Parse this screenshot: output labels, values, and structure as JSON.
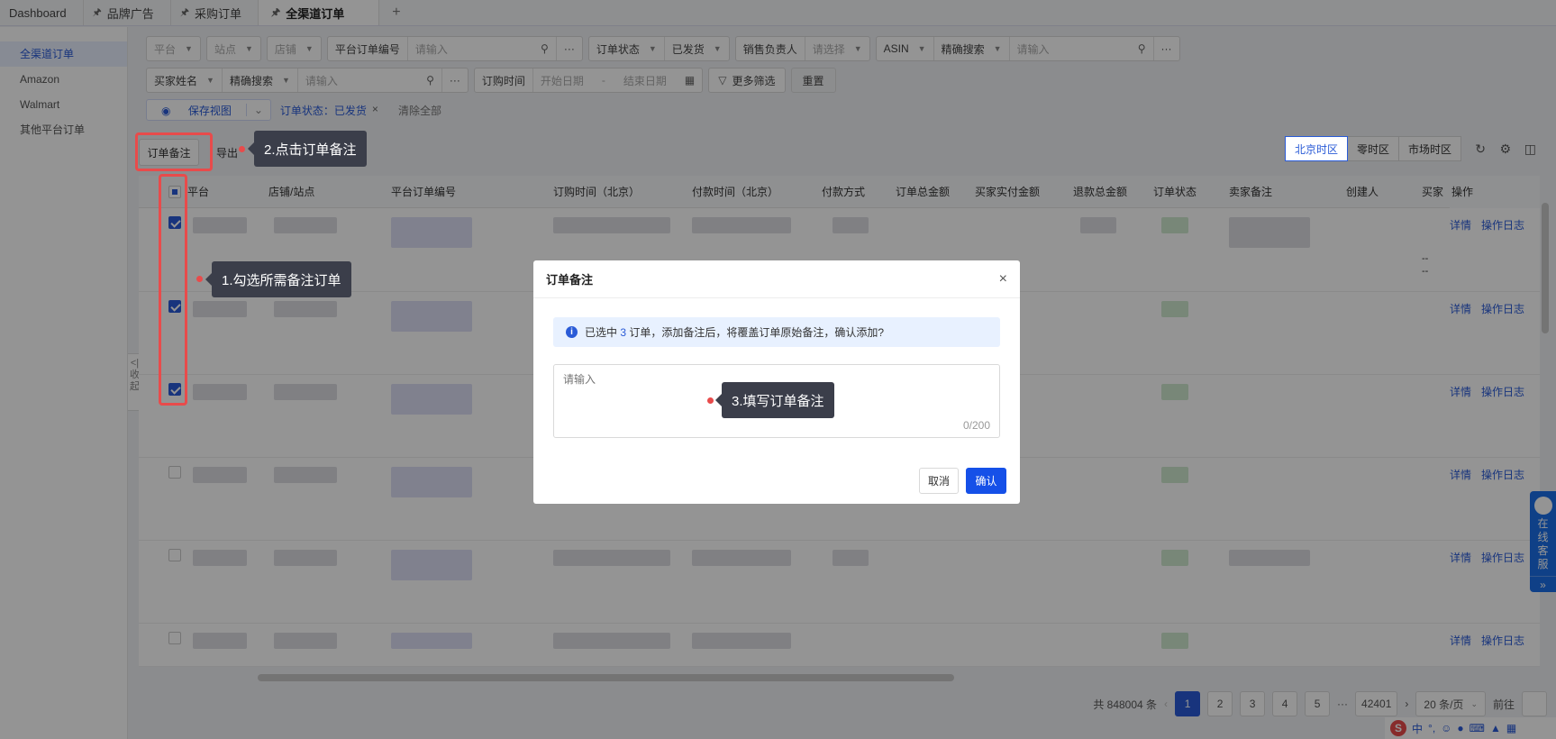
{
  "tabs": [
    {
      "label": "Dashboard",
      "pinned": false
    },
    {
      "label": "品牌广告",
      "pinned": true
    },
    {
      "label": "采购订单",
      "pinned": true
    },
    {
      "label": "全渠道订单",
      "pinned": true,
      "active": true
    }
  ],
  "tab_add": "+",
  "sidebar": {
    "items": [
      {
        "label": "全渠道订单",
        "active": true
      },
      {
        "label": "Amazon"
      },
      {
        "label": "Walmart"
      },
      {
        "label": "其他平台订单"
      }
    ],
    "collapse_label": "<| 收起"
  },
  "filters": {
    "platform": "平台",
    "site": "站点",
    "store": "店铺",
    "platform_order_no": "平台订单编号",
    "input_placeholder": "请输入",
    "order_status": "订单状态",
    "order_status_value": "已发货",
    "sales_owner": "销售负责人",
    "select_placeholder": "请选择",
    "asin": "ASIN",
    "exact_search": "精确搜索",
    "buyer_name": "买家姓名",
    "order_time": "订购时间",
    "start_date": "开始日期",
    "date_sep": "-",
    "end_date": "结束日期",
    "more_filters": "更多筛选",
    "reset": "重置",
    "save_view": "保存视图",
    "chip": "订单状态：已发货",
    "clear_all": "清除全部",
    "more": "···"
  },
  "toolbar": {
    "order_remark": "订单备注",
    "export": "导出",
    "tz_beijing": "北京时区",
    "tz_zero": "零时区",
    "tz_market": "市场时区"
  },
  "table": {
    "columns": [
      "平台",
      "店铺/站点",
      "平台订单编号",
      "订购时间（北京）",
      "付款时间（北京）",
      "付款方式",
      "订单总金额",
      "买家实付金额",
      "退款总金额",
      "订单状态",
      "卖家备注",
      "创建人",
      "买家",
      "操作"
    ],
    "rows": [
      {
        "checked": true,
        "extra": "--"
      },
      {
        "checked": true
      },
      {
        "checked": true
      },
      {
        "checked": false
      },
      {
        "checked": false
      },
      {
        "checked": false
      }
    ],
    "action_detail": "详情",
    "action_log": "操作日志",
    "dash": "--"
  },
  "pagination": {
    "total": "共 848004 条",
    "pages": [
      "1",
      "2",
      "3",
      "4",
      "5"
    ],
    "ellipsis": "···",
    "last_page": "42401",
    "page_size": "20 条/页",
    "goto": "前往",
    "current": 1
  },
  "modal": {
    "title": "订单备注",
    "alert_prefix": "已选中",
    "alert_count": "3",
    "alert_suffix": "订单，添加备注后，将覆盖订单原始备注，确认添加?",
    "textarea_placeholder": "请输入",
    "counter": "0/200",
    "cancel": "取消",
    "confirm": "确认"
  },
  "annotations": {
    "step1": "1.勾选所需备注订单",
    "step2": "2.点击订单备注",
    "step3": "3.填写订单备注"
  },
  "customer_service": {
    "label": "在线客服",
    "arrow": "»"
  },
  "ime": {
    "logo": "S",
    "mode": "中"
  },
  "colors": {
    "primary": "#2a5bd7",
    "confirm": "#1550e8",
    "annotation_red": "#e84b4b",
    "callout_bg": "#3b3e4a"
  }
}
